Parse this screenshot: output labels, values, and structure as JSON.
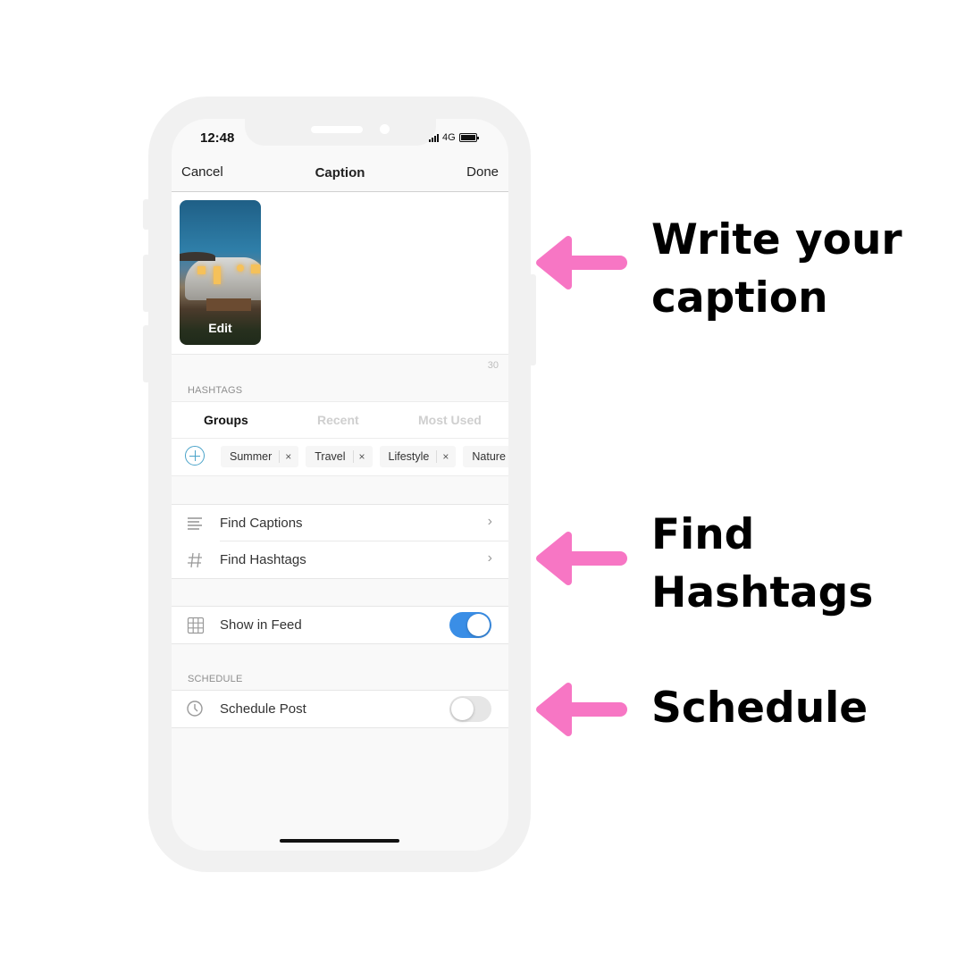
{
  "status_bar": {
    "time": "12:48",
    "network": "4G",
    "signal_icon": "signal-bars-icon",
    "battery_icon": "battery-icon"
  },
  "nav": {
    "cancel_label": "Cancel",
    "title": "Caption",
    "done_label": "Done"
  },
  "caption": {
    "thumbnail_edit_label": "Edit",
    "text_value": "",
    "char_count": "30"
  },
  "hashtags": {
    "section_label": "HASHTAGS",
    "tabs": [
      {
        "label": "Groups",
        "active": true
      },
      {
        "label": "Recent",
        "active": false
      },
      {
        "label": "Most Used",
        "active": false
      }
    ],
    "add_icon": "plus-circle-icon",
    "chips": [
      {
        "label": "Summer",
        "remove": "×"
      },
      {
        "label": "Travel",
        "remove": "×"
      },
      {
        "label": "Lifestyle",
        "remove": "×"
      },
      {
        "label": "Nature",
        "remove": "×"
      }
    ]
  },
  "tools": {
    "items": [
      {
        "label": "Find Captions",
        "icon": "text-lines-icon",
        "chevron": "›"
      },
      {
        "label": "Find Hashtags",
        "icon": "hash-icon",
        "chevron": "›"
      }
    ]
  },
  "feed": {
    "label": "Show in Feed",
    "icon": "grid-icon",
    "enabled": true
  },
  "schedule": {
    "section_label": "SCHEDULE",
    "label": "Schedule Post",
    "icon": "clock-icon",
    "enabled": false
  },
  "annotations": {
    "color": "#f776c4",
    "items": [
      {
        "lines": [
          "Write your",
          "caption"
        ]
      },
      {
        "lines": [
          "Find",
          "Hashtags"
        ]
      },
      {
        "lines": [
          "Schedule"
        ]
      }
    ]
  },
  "colors": {
    "toggle_on": "#3a8ee6",
    "add_icon": "#4aa3c9"
  }
}
